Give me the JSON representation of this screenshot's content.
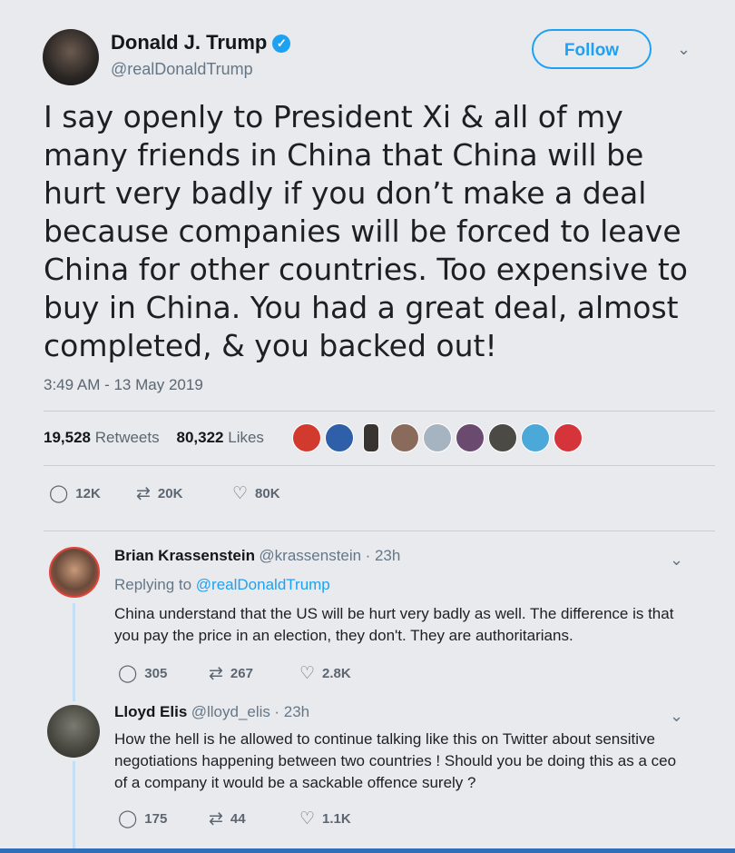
{
  "tweet": {
    "name": "Donald J. Trump",
    "handle": "@realDonaldTrump",
    "follow_label": "Follow",
    "text": "I say openly to President Xi & all of my many friends in China that China will be hurt very badly if you don’t make a deal because companies will be forced to leave China for other countries. Too expensive to buy in China. You had a great deal, almost completed, & you backed out!",
    "timestamp": "3:49 AM - 13 May 2019",
    "retweets_count": "19,528",
    "retweets_label": "Retweets",
    "likes_count": "80,322",
    "likes_label": "Likes",
    "actions": {
      "replies": "12K",
      "retweets": "20K",
      "likes": "80K"
    }
  },
  "replies": [
    {
      "name": "Brian Krassenstein",
      "handle": "@krassenstein",
      "time": "· 23h",
      "replying_to_prefix": "Replying to",
      "replying_to": "@realDonaldTrump",
      "text": "China understand that the US will be hurt very badly as well.  The difference is that you pay the price in an election, they don't.  They are authoritarians.",
      "actions": {
        "replies": "305",
        "retweets": "267",
        "likes": "2.8K"
      }
    },
    {
      "name": "Lloyd Elis",
      "handle": "@lloyd_elis",
      "time": "· 23h",
      "text": "How the hell is he allowed to continue talking like this on Twitter about sensitive negotiations happening between two countries ! Should you be doing this as a ceo of a company it would be a sackable offence surely ?",
      "actions": {
        "replies": "175",
        "retweets": "44",
        "likes": "1.1K"
      }
    }
  ],
  "icons": {
    "verified": "verified-badge-icon",
    "reply": "reply-icon",
    "retweet": "retweet-icon",
    "like": "heart-icon",
    "more": "chevron-down-icon"
  },
  "colors": {
    "accent": "#1da1f2",
    "secondary_text": "#657786",
    "thread_line": "#c2dff5"
  }
}
